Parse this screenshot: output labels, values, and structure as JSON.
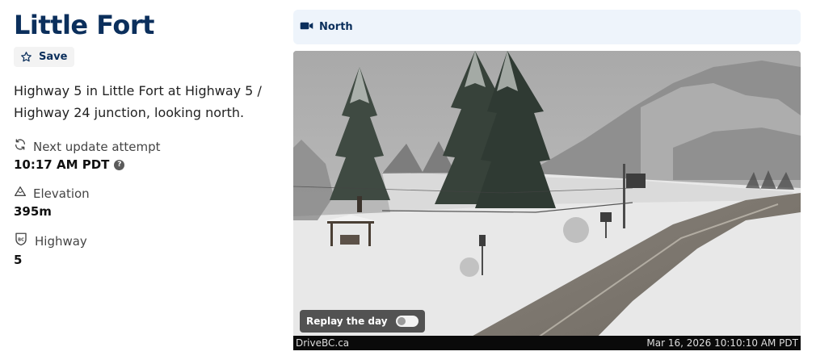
{
  "page": {
    "title": "Little Fort",
    "save_label": "Save",
    "description": "Highway 5 in Little Fort at Highway 5 / Highway 24 junction, looking north."
  },
  "info": {
    "next_update_label": "Next update attempt",
    "next_update_value": "10:17 AM PDT",
    "help_glyph": "?",
    "elevation_label": "Elevation",
    "elevation_value": "395m",
    "highway_label": "Highway",
    "highway_value": "5"
  },
  "camera": {
    "tab_label": "North",
    "replay_label": "Replay the day",
    "replay_enabled": false,
    "source": "DriveBC.ca",
    "timestamp": "Mar 16, 2026 10:10:10 AM PDT"
  },
  "colors": {
    "brand": "#0b2f5c",
    "tab_bg": "#eef4fb",
    "badge_bg": "#5b5b5b"
  },
  "icons": {
    "save": "star-outline-icon",
    "refresh": "refresh-icon",
    "elevation": "mountain-icon",
    "highway": "bc-shield-icon",
    "camera": "video-camera-icon"
  }
}
